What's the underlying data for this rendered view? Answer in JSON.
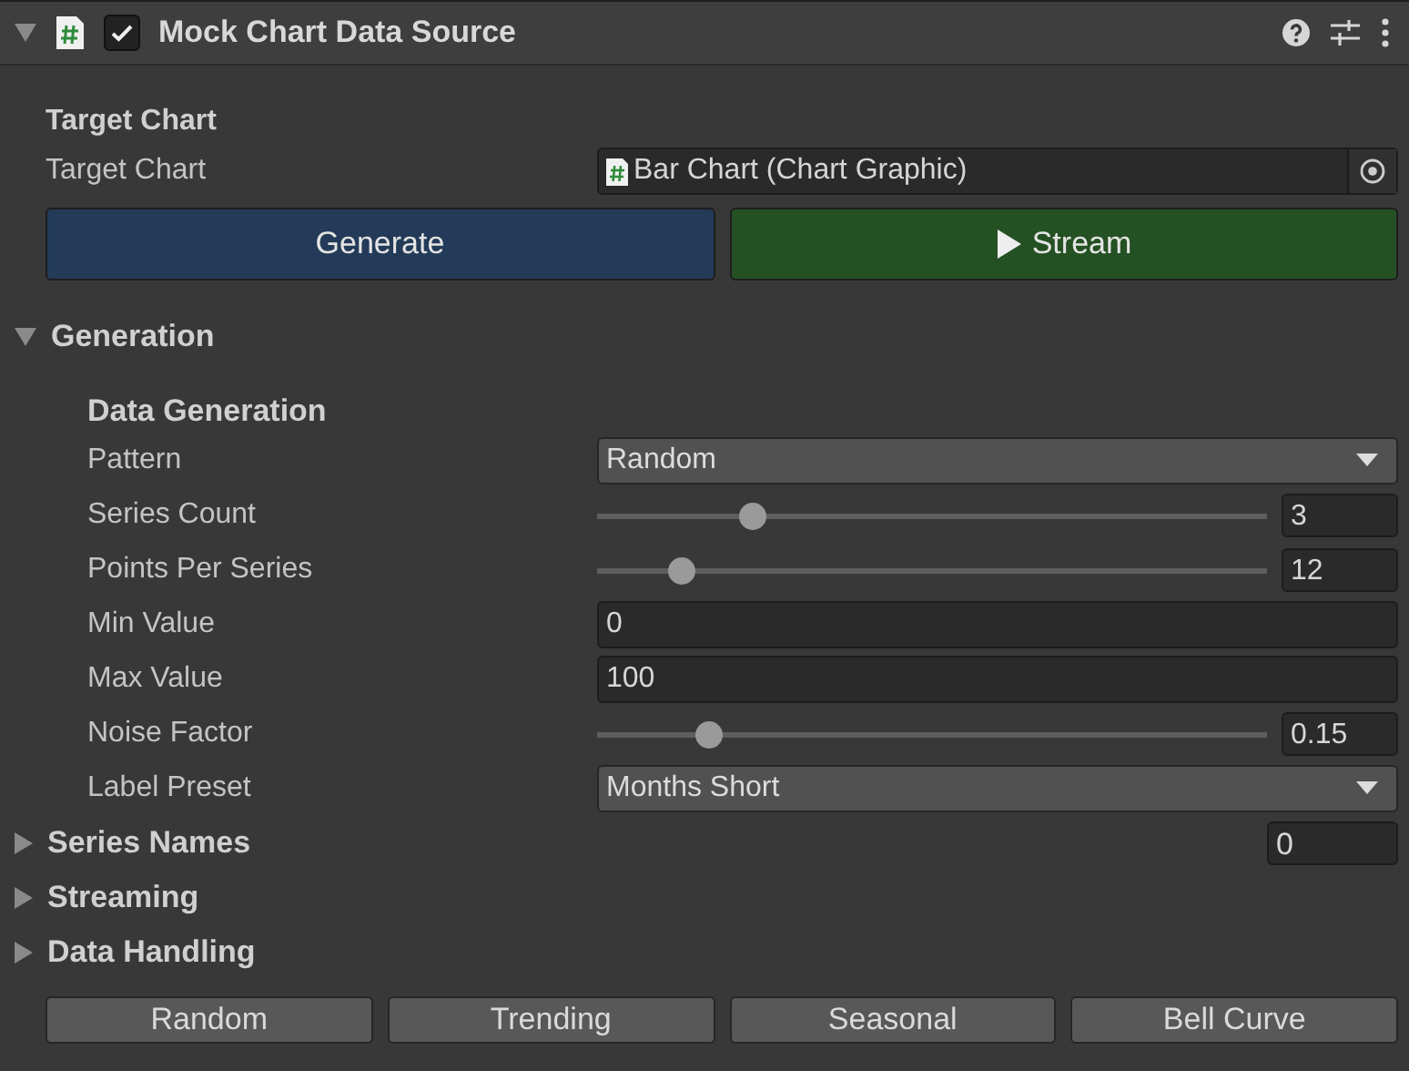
{
  "header": {
    "title": "Mock Chart Data Source",
    "enabled": true,
    "expanded": true
  },
  "target": {
    "heading": "Target Chart",
    "label": "Target Chart",
    "value": "Bar Chart (Chart Graphic)"
  },
  "actions": {
    "generate": "Generate",
    "stream": "Stream"
  },
  "generation": {
    "title": "Generation",
    "expanded": true,
    "subheading": "Data Generation",
    "fields": [
      {
        "kind": "dropdown",
        "label": "Pattern",
        "value": "Random"
      },
      {
        "kind": "slider",
        "label": "Series Count",
        "level": 0.23,
        "value": "3"
      },
      {
        "kind": "slider",
        "label": "Points Per Series",
        "level": 0.125,
        "value": "12"
      },
      {
        "kind": "number",
        "label": "Min Value",
        "value": "0"
      },
      {
        "kind": "number",
        "label": "Max Value",
        "value": "100"
      },
      {
        "kind": "slider",
        "label": "Noise Factor",
        "level": 0.165,
        "value": "0.15"
      },
      {
        "kind": "dropdown",
        "label": "Label Preset",
        "value": "Months Short"
      }
    ]
  },
  "sections": [
    {
      "title": "Series Names",
      "expanded": false,
      "count": "0"
    },
    {
      "title": "Streaming",
      "expanded": false
    },
    {
      "title": "Data Handling",
      "expanded": false
    }
  ],
  "presets": [
    "Random",
    "Trending",
    "Seasonal",
    "Bell Curve"
  ]
}
